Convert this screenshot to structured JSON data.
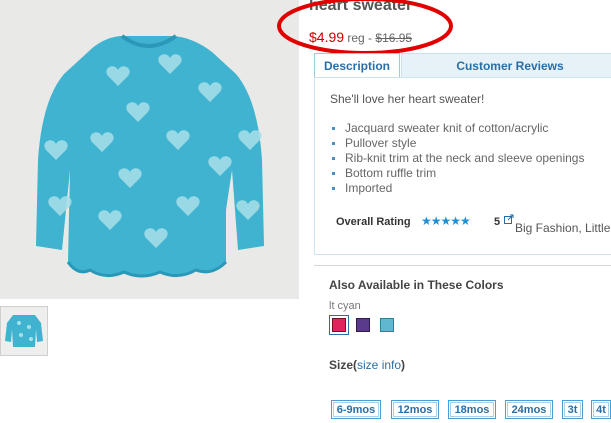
{
  "product": {
    "title": "heart sweater",
    "sale_price": "$4.99",
    "reg_label": " reg - ",
    "reg_price": "$16.95"
  },
  "tabs": [
    {
      "label": "Description",
      "active": true
    },
    {
      "label": "Customer Reviews",
      "active": false
    }
  ],
  "description": {
    "tagline": "She'll love her heart sweater!",
    "features": [
      "Jacquard sweater knit of cotton/acrylic",
      "Pullover style",
      "Rib-knit trim at the neck and sleeve openings",
      "Bottom ruffle trim",
      "Imported"
    ]
  },
  "rating": {
    "label": "Overall Rating",
    "stars_glyph": "★★★★★",
    "value": "5",
    "source": "Big Fashion, Little"
  },
  "colors": {
    "title": "Also Available in These Colors",
    "selected_name": "lt cyan",
    "swatches": [
      {
        "name": "pink",
        "color": "#e0245e"
      },
      {
        "name": "purple",
        "color": "#5a3a8a"
      },
      {
        "name": "lt cyan",
        "color": "#5fb8d0",
        "selected": true
      }
    ]
  },
  "sizes": {
    "label": "Size",
    "info_prefix": "(",
    "info_link": "size info",
    "info_suffix": ")",
    "options": [
      "6-9mos",
      "12mos",
      "18mos",
      "24mos",
      "3t",
      "4t"
    ]
  },
  "theme": {
    "accent": "#2a6ea6",
    "sale_red": "#cc0000",
    "sweater_blue": "#3fb3cf",
    "highlight_red": "#e00000"
  }
}
